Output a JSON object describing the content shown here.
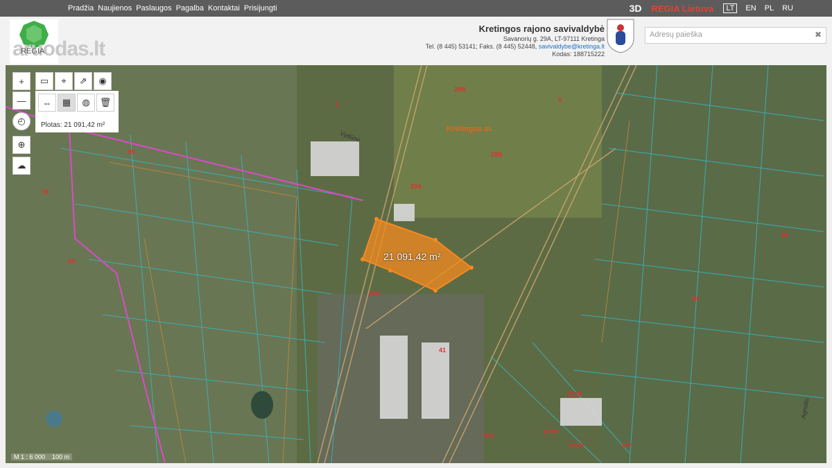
{
  "topbar": {
    "nav": [
      "Pradžia",
      "Naujienos",
      "Paslaugos",
      "Pagalba",
      "Kontaktai",
      "Prisijungti"
    ],
    "view3d": "3D",
    "brand": "REGIA Lietuva",
    "languages": [
      "LT",
      "EN",
      "PL",
      "RU"
    ],
    "active_language": "LT"
  },
  "header": {
    "logo_text": "REGIA",
    "watermark": "aruodas.lt",
    "municipality": {
      "name": "Kretingos rajono savivaldybė",
      "address": "Savanorių g. 29A, LT-97111 Kretinga",
      "contacts_prefix": "Tel. (8 445) 53141; Faks. (8 445) 52448,",
      "email": "savivaldybe@kretinga.lt",
      "code": "Kodas: 188715222"
    },
    "search_placeholder": "Adresų paieška"
  },
  "map": {
    "measurement": "Plotas: 21 091,42 m²",
    "area_label": "21 091,42 m²",
    "town": "Kretingos m.",
    "scale": "M 1 : 6 000",
    "scale_bar": "100 m",
    "streets": [
      "Vydūno",
      "Agnolio"
    ],
    "parcel_labels": [
      "29B",
      "29A",
      "29B",
      "5",
      "3",
      "43B",
      "41",
      "60",
      "84",
      "78",
      "80",
      "127N",
      "127B",
      "127O",
      "76A",
      "127",
      "84"
    ],
    "colors": {
      "highlight": "#f58a1f",
      "parcel_lines": "#35b8c6",
      "boundary": "#d94bc9",
      "label": "#e03030"
    }
  }
}
